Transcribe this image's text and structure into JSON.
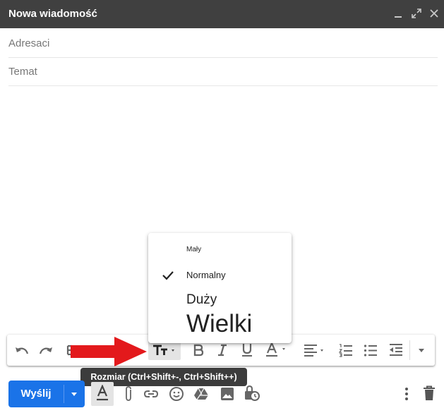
{
  "window": {
    "title": "Nowa wiadomość"
  },
  "fields": {
    "to_label": "Adresaci",
    "subject_label": "Temat"
  },
  "size_menu": {
    "items": [
      "Mały",
      "Normalny",
      "Duży",
      "Wielki"
    ],
    "selected": "Normalny"
  },
  "tooltip": "Rozmiar (Ctrl+Shift+-, Ctrl+Shift++)",
  "send": {
    "label": "Wyślij"
  },
  "colors": {
    "send_blue": "#1a73e8",
    "titlebar": "#404040",
    "arrow_red": "#e3191c",
    "tooltip_bg": "#3c3c3c"
  },
  "toolbar_icons": [
    "undo-icon",
    "redo-icon",
    "font-icon",
    "text-size-icon",
    "bold-icon",
    "italic-icon",
    "underline-icon",
    "text-color-icon",
    "align-icon",
    "numbered-list-icon",
    "bulleted-list-icon",
    "indent-less-icon",
    "more-options-icon"
  ],
  "bottom_icons": [
    "formatting-icon",
    "attach-icon",
    "link-icon",
    "emoji-icon",
    "drive-icon",
    "photo-icon",
    "confidential-mode-icon",
    "more-options-icon",
    "trash-icon"
  ]
}
